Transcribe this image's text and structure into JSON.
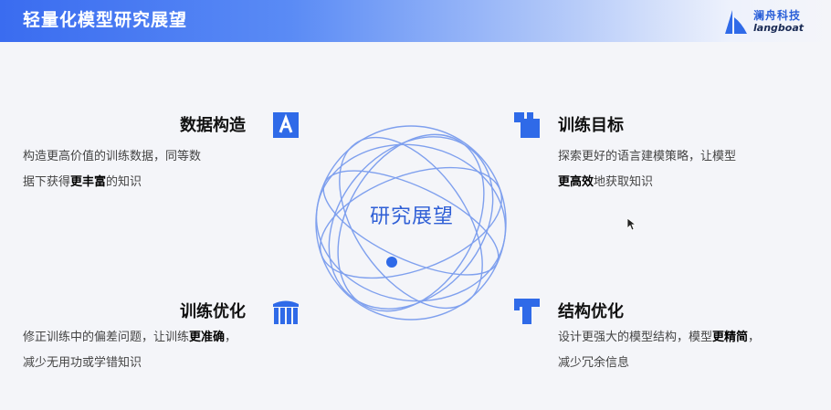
{
  "header": {
    "title": "轻量化模型研究展望",
    "logo_cn": "澜舟科技",
    "logo_en": "langboat"
  },
  "center": {
    "label": "研究展望"
  },
  "sections": {
    "data": {
      "title": "数据构造",
      "icon": "letter-a-icon",
      "line1": "构造更高价值的训练数据，同等数",
      "line2_pre": "据下获得",
      "line2_bold": "更丰富",
      "line2_post": "的知识"
    },
    "goal": {
      "title": "训练目标",
      "icon": "squares-icon",
      "line1": "探索更好的语言建模策略，让模型",
      "line2_bold": "更高效",
      "line2_post": "地获取知识"
    },
    "train": {
      "title": "训练优化",
      "icon": "columns-icon",
      "line1_pre": "修正训练中的偏差问题，让训练",
      "line1_bold": "更准确",
      "line1_post": "，",
      "line2": "减少无用功或学错知识"
    },
    "struct": {
      "title": "结构优化",
      "icon": "letter-t-icon",
      "line1_pre": "设计更强大的模型结构，模型",
      "line1_bold": "更精简",
      "line1_post": "，",
      "line2": "减少冗余信息"
    }
  },
  "colors": {
    "accent": "#2f5fd6",
    "brand": "#3a6cf0"
  }
}
